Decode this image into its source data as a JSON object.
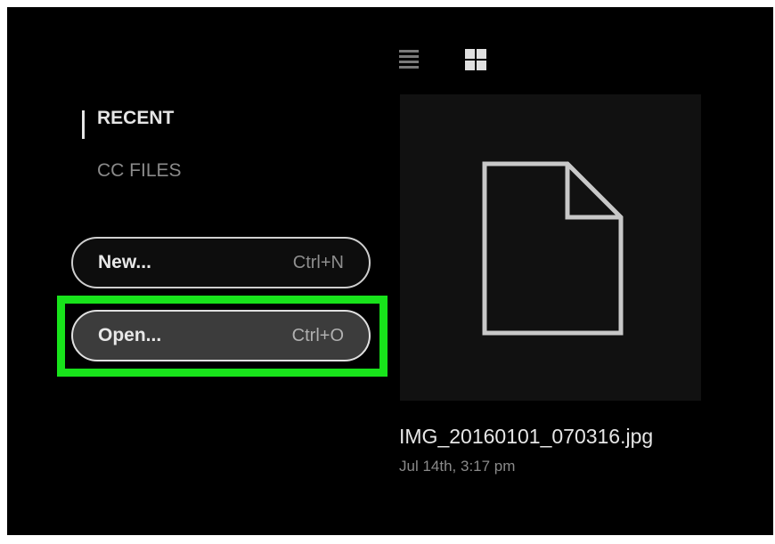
{
  "sidebar": {
    "items": [
      {
        "label": "RECENT",
        "active": true
      },
      {
        "label": "CC FILES",
        "active": false
      }
    ]
  },
  "actions": {
    "new": {
      "label": "New...",
      "shortcut": "Ctrl+N"
    },
    "open": {
      "label": "Open...",
      "shortcut": "Ctrl+O",
      "highlighted": true
    }
  },
  "view_toggles": {
    "list_icon": "list-view-icon",
    "grid_icon": "grid-view-icon"
  },
  "recent_files": [
    {
      "name": "IMG_20160101_070316.jpg",
      "date": "Jul 14th, 3:17 pm",
      "icon": "document-icon"
    }
  ],
  "colors": {
    "background": "#000000",
    "highlight": "#18e31b",
    "text_primary": "#e6e6e6",
    "text_secondary": "#8a8a8a"
  }
}
